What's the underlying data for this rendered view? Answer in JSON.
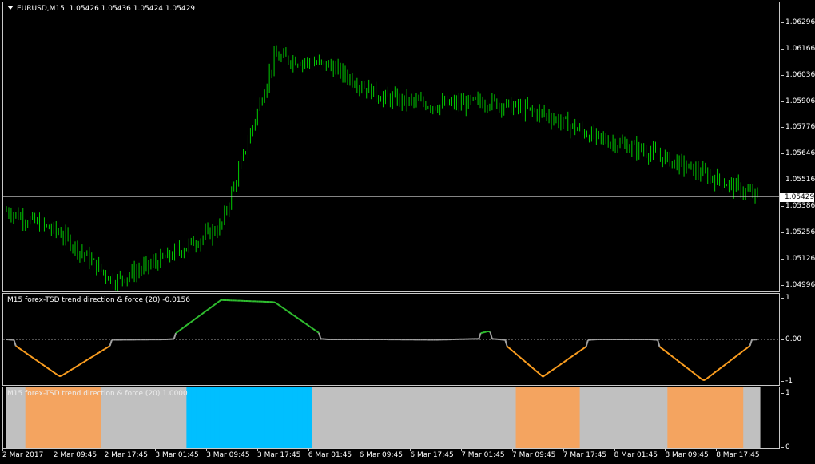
{
  "main": {
    "symbol": "EURUSD,M15",
    "ohlc": "1.05426 1.05436 1.05424 1.05429",
    "current_price_label": "1.05429",
    "current_price": 1.05429,
    "price_ticks": [
      "1.06296",
      "1.06166",
      "1.06036",
      "1.05906",
      "1.05776",
      "1.05646",
      "1.05516",
      "1.05386",
      "1.05256",
      "1.05126",
      "1.04996"
    ],
    "price_range": [
      1.0496,
      1.0639
    ],
    "candle_color": "#00cc00"
  },
  "indicator1": {
    "title": "M15 forex-TSD trend direction & force (20) -0.0156",
    "ticks": [
      "1",
      "0.00",
      "-1"
    ],
    "range": [
      -1.1,
      1.1
    ],
    "colors": {
      "neutral": "#a0a0a0",
      "up": "#30c030",
      "down": "#ffa020",
      "level": "#a0a0a0"
    }
  },
  "indicator2": {
    "title": "M15 forex-TSD trend direction & force (20) 1.0000",
    "ticks": [
      "1",
      "0"
    ],
    "colors": {
      "neutral": "#c0c0c0",
      "up": "#00bfff",
      "down": "#f4a460"
    }
  },
  "time_labels": [
    "2 Mar 2017",
    "2 Mar 09:45",
    "2 Mar 17:45",
    "3 Mar 01:45",
    "3 Mar 09:45",
    "3 Mar 17:45",
    "6 Mar 01:45",
    "6 Mar 09:45",
    "6 Mar 17:45",
    "7 Mar 01:45",
    "7 Mar 09:45",
    "7 Mar 17:45",
    "8 Mar 01:45",
    "8 Mar 09:45",
    "8 Mar 17:45"
  ],
  "chart_data": [
    {
      "type": "line",
      "title": "EURUSD,M15",
      "xlabel": "",
      "ylabel": "",
      "x": [
        "2 Mar 2017",
        "2 Mar 09:45",
        "2 Mar 17:45",
        "3 Mar 01:45",
        "3 Mar 09:45",
        "3 Mar 17:45",
        "6 Mar 01:45",
        "6 Mar 09:45",
        "6 Mar 17:45",
        "7 Mar 01:45",
        "7 Mar 09:45",
        "7 Mar 17:45",
        "8 Mar 01:45",
        "8 Mar 09:45",
        "8 Mar 17:45"
      ],
      "series": [
        {
          "name": "EURUSD,M15",
          "values": [
            1.0536,
            1.0525,
            1.0501,
            1.0513,
            1.0528,
            1.0612,
            1.0608,
            1.0592,
            1.0588,
            1.059,
            1.0584,
            1.0572,
            1.0565,
            1.0554,
            1.0543
          ]
        }
      ],
      "ylim": [
        1.0496,
        1.0639
      ]
    },
    {
      "type": "line",
      "title": "M15 forex-TSD trend direction & force (20) -0.0156",
      "x": [
        "2 Mar 2017",
        "2 Mar 09:45",
        "2 Mar 17:45",
        "3 Mar 01:45",
        "3 Mar 09:45",
        "3 Mar 17:45",
        "6 Mar 01:45",
        "6 Mar 09:45",
        "6 Mar 17:45",
        "7 Mar 01:45",
        "7 Mar 09:45",
        "7 Mar 17:45",
        "8 Mar 01:45",
        "8 Mar 09:45",
        "8 Mar 17:45"
      ],
      "series": [
        {
          "name": "trend direction & force",
          "values": [
            0,
            -0.9,
            -0.1,
            0,
            0.95,
            0.9,
            0,
            0,
            -0.1,
            0.2,
            -0.9,
            0,
            0,
            -1.0,
            -0.0156
          ]
        }
      ],
      "ylim": [
        -1.1,
        1.1
      ]
    },
    {
      "type": "bar",
      "title": "M15 forex-TSD trend direction & force (20) 1.0000",
      "x": [
        "2 Mar 2017",
        "2 Mar 09:45",
        "2 Mar 17:45",
        "3 Mar 01:45",
        "3 Mar 09:45",
        "3 Mar 17:45",
        "6 Mar 01:45",
        "6 Mar 09:45",
        "6 Mar 17:45",
        "7 Mar 01:45",
        "7 Mar 09:45",
        "7 Mar 17:45",
        "8 Mar 01:45",
        "8 Mar 09:45",
        "8 Mar 17:45"
      ],
      "series": [
        {
          "name": "state",
          "values": [
            1,
            1,
            1,
            1,
            1,
            1,
            1,
            1,
            1,
            1,
            1,
            1,
            1,
            1,
            1
          ]
        }
      ],
      "ylim": [
        0,
        1
      ]
    }
  ]
}
